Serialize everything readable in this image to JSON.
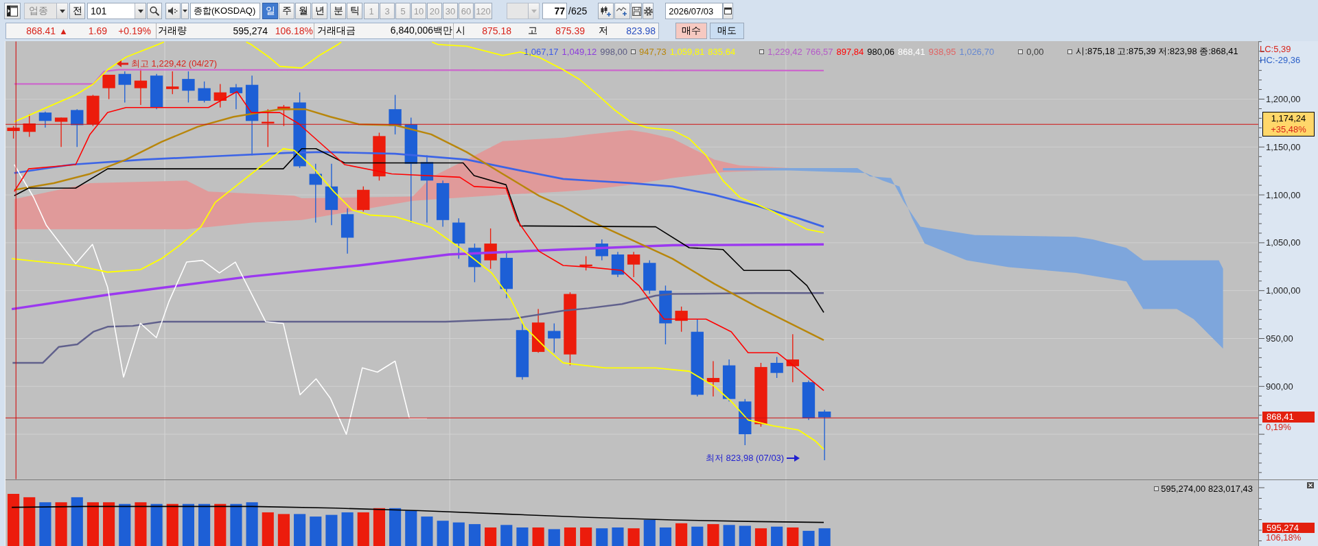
{
  "toolbar": {
    "sector": {
      "value": "업종",
      "disabled": true
    },
    "prev_button": "전",
    "code": {
      "value": "101"
    },
    "index_name": "종합(KOSDAQ)",
    "periods": [
      {
        "label": "일",
        "selected": true
      },
      {
        "label": "주",
        "selected": false
      },
      {
        "label": "월",
        "selected": false
      },
      {
        "label": "년",
        "selected": false
      },
      {
        "label": "분",
        "selected": false
      },
      {
        "label": "틱",
        "selected": false
      }
    ],
    "intervals": [
      {
        "label": "1",
        "disabled": true
      },
      {
        "label": "3",
        "disabled": true
      },
      {
        "label": "5",
        "disabled": true
      },
      {
        "label": "10",
        "disabled": true
      },
      {
        "label": "20",
        "disabled": true
      },
      {
        "label": "30",
        "disabled": true
      },
      {
        "label": "60",
        "disabled": true
      },
      {
        "label": "120",
        "disabled": true
      }
    ],
    "interval_combo": {
      "disabled": true
    },
    "count": {
      "value": "77",
      "total": "/625"
    },
    "date": "2026/07/03"
  },
  "quote": {
    "rising": true,
    "price": "868.41",
    "arrow": "▲",
    "change": "1.69",
    "change_rate": "+0.19%",
    "volume_label": "거래량",
    "volume": "595,274",
    "volume_rate": "106.18%",
    "amount_label": "거래대금",
    "amount": "6,840,006백만",
    "open_label": "시",
    "open": "875.18",
    "high_label": "고",
    "high": "875.39",
    "low_label": "저",
    "low": "823.98"
  },
  "order_buttons": [
    {
      "label": "매수",
      "kind": "buy"
    },
    {
      "label": "매도",
      "kind": "sell"
    }
  ],
  "price_chart": {
    "legend": [
      {
        "marker": false,
        "items": [
          {
            "text": "1,067,17",
            "color": "#3c5ae6"
          },
          {
            "text": "1,049,12",
            "color": "#8c3cdc"
          },
          {
            "text": "998,00",
            "color": "#5a5a82"
          }
        ]
      },
      {
        "marker": true,
        "items": [
          {
            "text": "947,73",
            "color": "#b8860b"
          },
          {
            "text": "1,059,81",
            "color": "#ffff00"
          },
          {
            "text": "835,64",
            "color": "#ffff00"
          }
        ]
      },
      {
        "marker": true,
        "items": [
          {
            "text": "1,229,42",
            "color": "#b45ac8"
          },
          {
            "text": "766,57",
            "color": "#b45ac8"
          },
          {
            "text": "897,84",
            "color": "#ff0000"
          },
          {
            "text": "980,06",
            "color": "#000000"
          },
          {
            "text": "868,41",
            "color": "#ffffff"
          },
          {
            "text": "938,95",
            "color": "#e06464"
          },
          {
            "text": "1,026,70",
            "color": "#6688d0"
          }
        ]
      },
      {
        "marker": true,
        "items": [
          {
            "text": "0,00",
            "color": "#3a3a3a"
          }
        ]
      },
      {
        "marker": true,
        "items": [
          {
            "text": "시:875,18 고:875,39 저:823,98 종:868,41",
            "color": "#000000"
          }
        ]
      }
    ],
    "high_note": "최고 1,229,42 (04/27)",
    "low_note": "최저 823,98 (07/03)",
    "axis": {
      "lc": "LC:5,39",
      "hc": "HC:-29,36",
      "labels": [
        "1,200,00",
        "1,150,00",
        "1,100,00",
        "1,050,00",
        "1,000,00",
        "950,00",
        "900,00"
      ],
      "reference_tag": {
        "price": "1,174,24",
        "change": "+35,48%"
      },
      "last_tag": {
        "price": "868,41",
        "change": "0,19%"
      }
    }
  },
  "volume_chart": {
    "legend": "595,274,00 823,017,43",
    "last_tag": {
      "value": "595,274",
      "change": "106,18%"
    }
  }
}
